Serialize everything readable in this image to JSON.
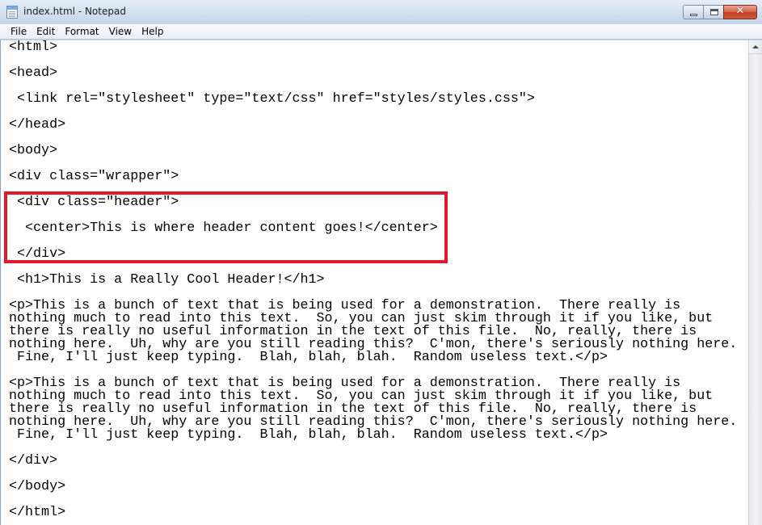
{
  "window": {
    "title": "index.html - Notepad"
  },
  "menu": {
    "items": [
      "File",
      "Edit",
      "Format",
      "View",
      "Help"
    ]
  },
  "editor": {
    "lines": [
      "<html>",
      "",
      "<head>",
      "",
      " <link rel=\"stylesheet\" type=\"text/css\" href=\"styles/styles.css\">",
      "",
      "</head>",
      "",
      "<body>",
      "",
      "<div class=\"wrapper\">",
      "",
      " <div class=\"header\">",
      "",
      "  <center>This is where header content goes!</center>",
      "",
      " </div>",
      "",
      " <h1>This is a Really Cool Header!</h1>",
      "",
      "<p>This is a bunch of text that is being used for a demonstration.  There really is",
      "nothing much to read into this text.  So, you can just skim through it if you like, but",
      "there is really no useful information in the text of this file.  No, really, there is",
      "nothing here.  Uh, why are you still reading this?  C'mon, there's seriously nothing here.",
      " Fine, I'll just keep typing.  Blah, blah, blah.  Random useless text.</p>",
      "",
      "<p>This is a bunch of text that is being used for a demonstration.  There really is",
      "nothing much to read into this text.  So, you can just skim through it if you like, but",
      "there is really no useful information in the text of this file.  No, really, there is",
      "nothing here.  Uh, why are you still reading this?  C'mon, there's seriously nothing here.",
      " Fine, I'll just keep typing.  Blah, blah, blah.  Random useless text.</p>",
      "",
      "</div>",
      "",
      "</body>",
      "",
      "</html>"
    ],
    "highlight_color": "#e0192a"
  },
  "icons": {
    "app": "notepad-icon",
    "minimize": "minimize-icon",
    "maximize": "maximize-icon",
    "close": "close-icon",
    "scroll_up": "scroll-up-arrow-icon"
  }
}
